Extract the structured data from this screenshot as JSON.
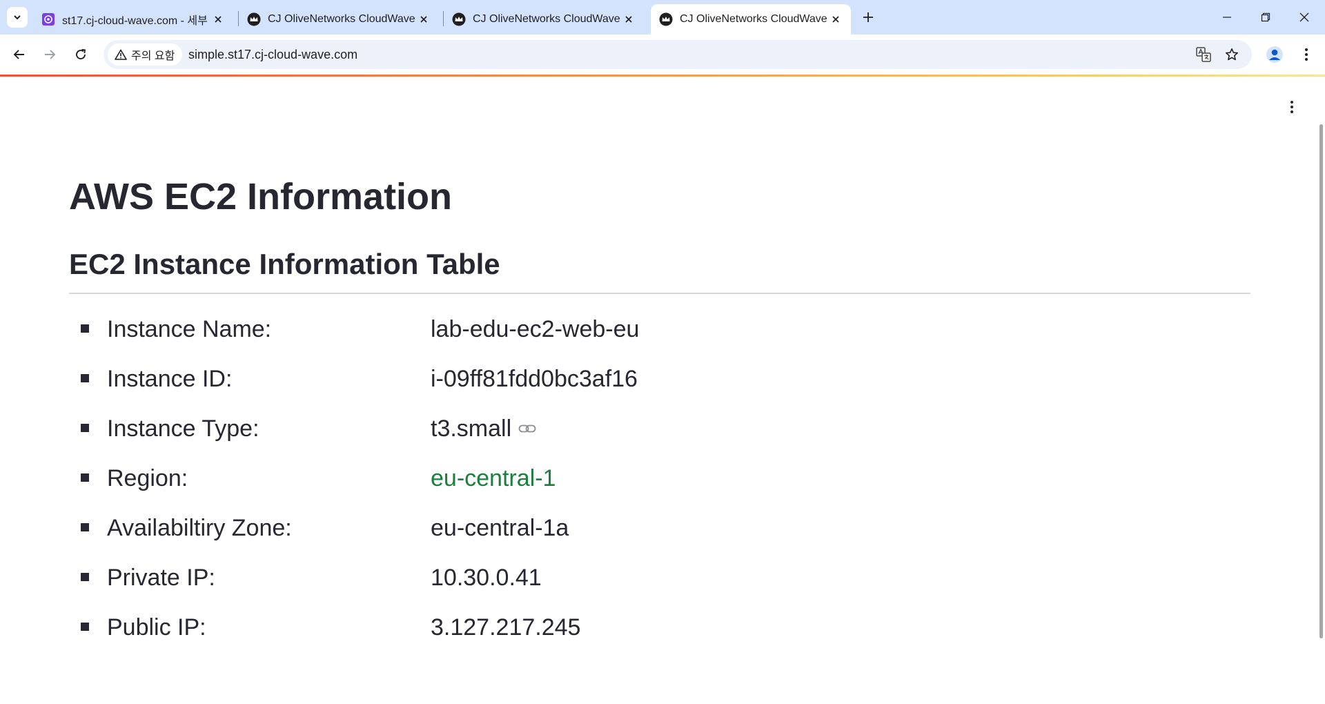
{
  "browser": {
    "tabs": [
      {
        "title": "st17.cj-cloud-wave.com - 세부",
        "favicon": "purple-app-icon",
        "active": false
      },
      {
        "title": "CJ OliveNetworks CloudWave",
        "favicon": "crown-icon",
        "active": false
      },
      {
        "title": "CJ OliveNetworks CloudWave",
        "favicon": "crown-icon",
        "active": false
      },
      {
        "title": "CJ OliveNetworks CloudWave",
        "favicon": "crown-icon",
        "active": true
      }
    ],
    "security_chip": "주의 요함",
    "url": "simple.st17.cj-cloud-wave.com"
  },
  "page": {
    "title": "AWS EC2 Information",
    "subtitle": "EC2 Instance Information Table",
    "rows": [
      {
        "label": "Instance Name:",
        "value": "lab-edu-ec2-web-eu"
      },
      {
        "label": "Instance ID:",
        "value": "i-09ff81fdd0bc3af16"
      },
      {
        "label": "Instance Type:",
        "value": "t3.small"
      },
      {
        "label": "Region:",
        "value": "eu-central-1"
      },
      {
        "label": "Availabiltiry Zone:",
        "value": "eu-central-1a"
      },
      {
        "label": "Private IP:",
        "value": "10.30.0.41"
      },
      {
        "label": "Public IP:",
        "value": "3.127.217.245"
      }
    ]
  },
  "colors": {
    "tabstrip": "#d3e3fd",
    "omnibox": "#edf2fa",
    "text": "#262730",
    "region_value": "#1b7f3e",
    "rule": "#d6d6d9"
  }
}
